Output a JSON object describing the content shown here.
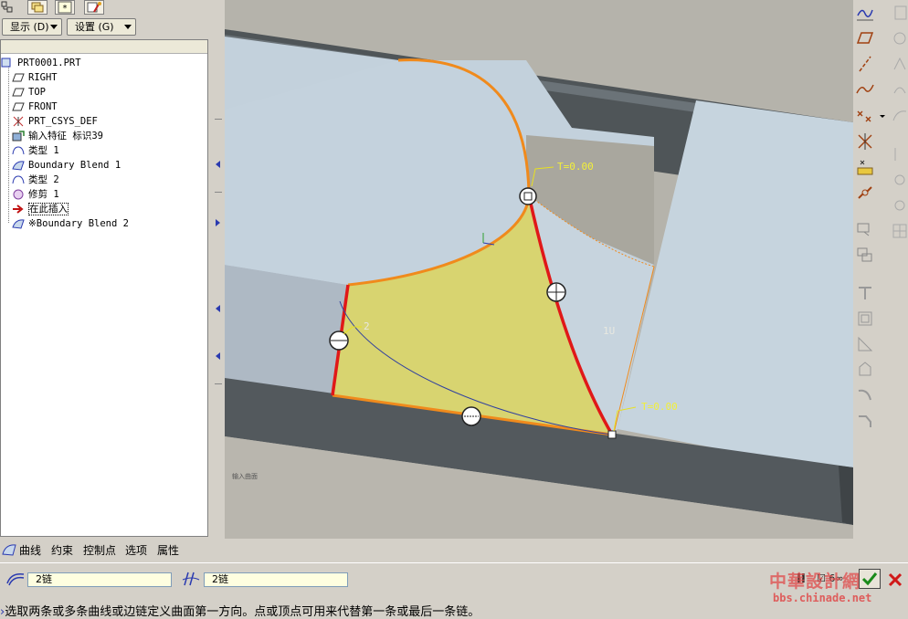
{
  "menu": {
    "display_label": "显示 (D)",
    "settings_label": "设置 (G)"
  },
  "model_tree": {
    "root": "PRT0001.PRT",
    "items": [
      {
        "label": "RIGHT",
        "icon": "datum-plane-icon"
      },
      {
        "label": "TOP",
        "icon": "datum-plane-icon"
      },
      {
        "label": "FRONT",
        "icon": "datum-plane-icon"
      },
      {
        "label": "PRT_CSYS_DEF",
        "icon": "csys-icon"
      },
      {
        "label": "输入特征 标识39",
        "icon": "import-feature-icon"
      },
      {
        "label": "类型 1",
        "icon": "surface-icon"
      },
      {
        "label": "Boundary Blend 1",
        "icon": "boundary-blend-icon"
      },
      {
        "label": "类型 2",
        "icon": "surface-icon"
      },
      {
        "label": "修剪 1",
        "icon": "trim-icon"
      },
      {
        "label": "在此插入",
        "icon": "insert-here-arrow-icon"
      },
      {
        "label": "※Boundary Blend 2",
        "icon": "boundary-blend-icon"
      }
    ]
  },
  "viewport": {
    "label_t_top": "T=0.00",
    "label_t_bottom": "T=0.00",
    "label_u": "1U",
    "label_2": "2",
    "small_note": "输入曲面"
  },
  "dashboard": {
    "tabs": [
      "曲线",
      "约束",
      "控制点",
      "选项",
      "属性"
    ],
    "chain1": "2链",
    "chain2": "2链",
    "pause_label": "II",
    "preview_label": "☑ 6∞",
    "watermark_cn": "中華設計網",
    "watermark_url": "bbs.chinade.net"
  },
  "status": {
    "message": "选取两条或多条曲线或边链定义曲面第一方向。点或顶点可用来代替第一条或最后一条链。"
  },
  "colors": {
    "surface_light": "#c3d1dc",
    "surface_dark": "#575d62",
    "background": "#b5b3ab",
    "blend_yellow": "#d8d470",
    "chain_red": "#e01818",
    "edge_orange": "#f08a1c",
    "accent_blue": "#2a3ab0"
  }
}
